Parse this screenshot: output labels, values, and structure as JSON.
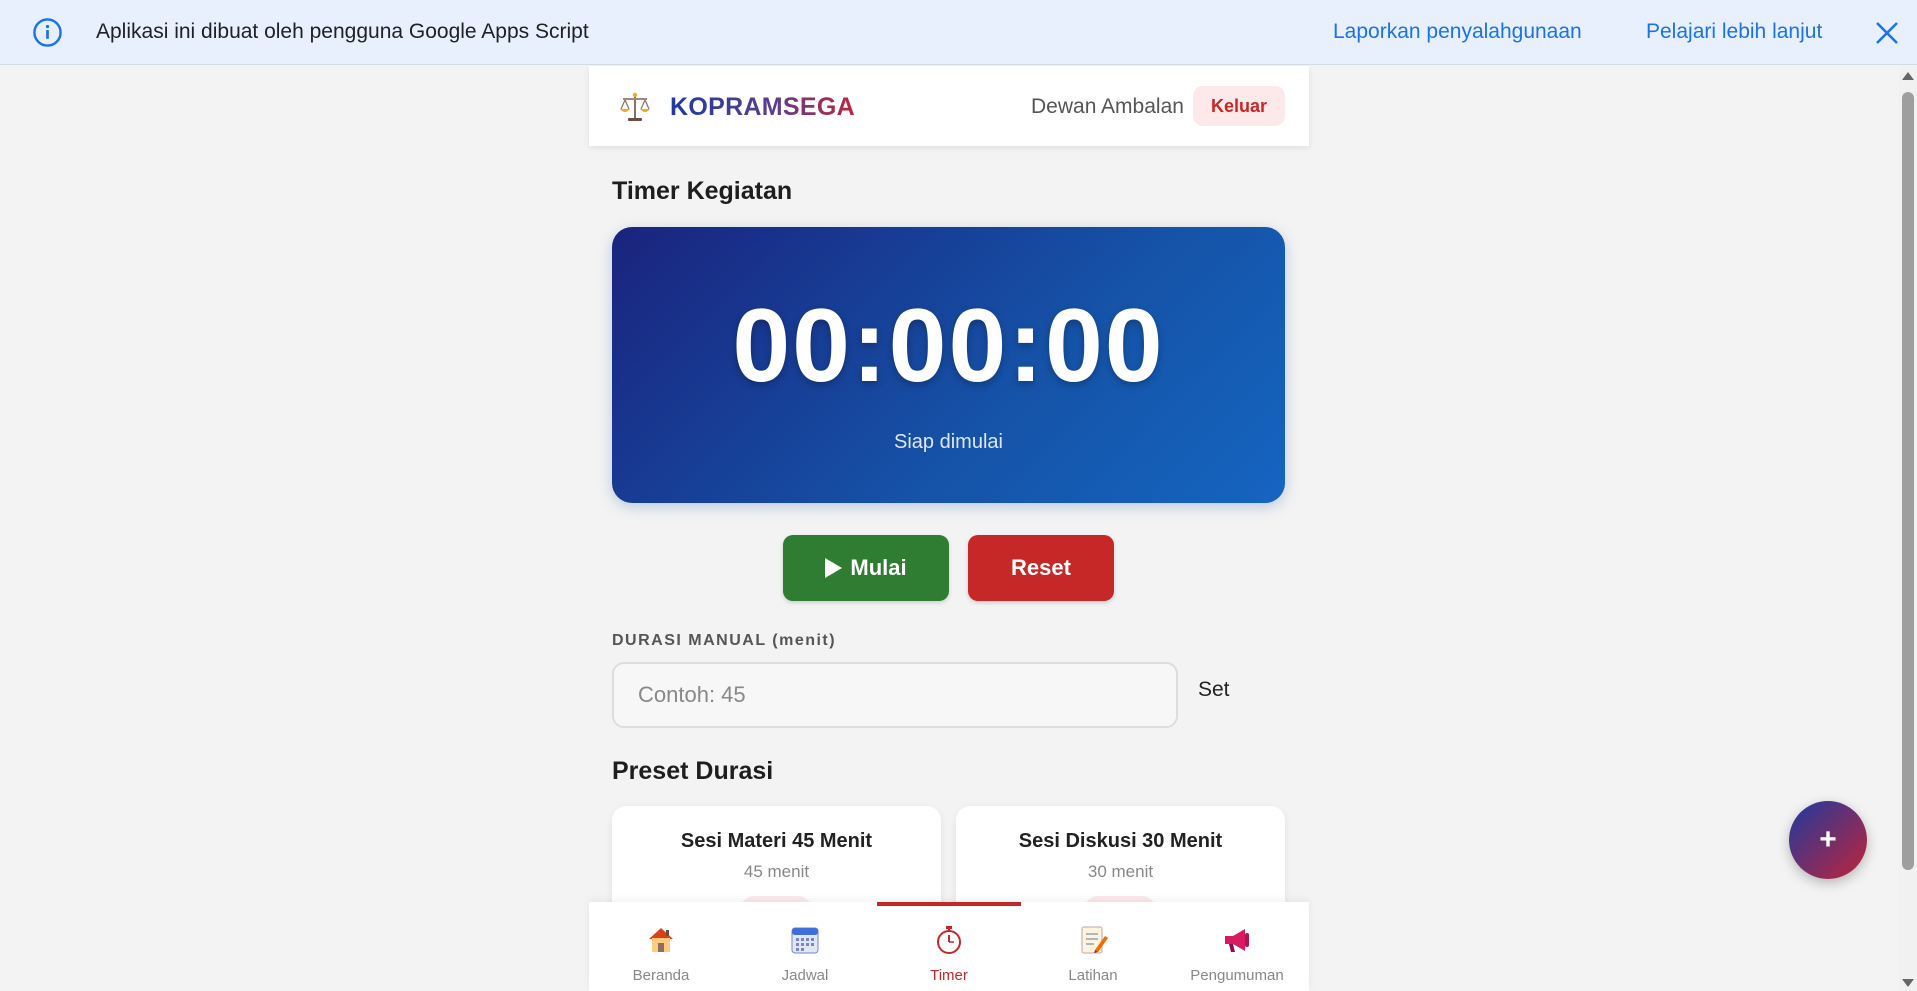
{
  "banner": {
    "message": "Aplikasi ini dibuat oleh pengguna Google Apps Script",
    "report_link": "Laporkan penyalahgunaan",
    "learn_link": "Pelajari lebih lanjut"
  },
  "header": {
    "brand": "KOPRAMSEGA",
    "user": "Dewan Ambalan",
    "logout": "Keluar"
  },
  "timer": {
    "section_title": "Timer Kegiatan",
    "display": "00:00:00",
    "status": "Siap dimulai",
    "start_label": "Mulai",
    "reset_label": "Reset"
  },
  "manual": {
    "label": "DURASI MANUAL (menit)",
    "placeholder": "Contoh: 45",
    "value": "",
    "set_label": "Set"
  },
  "presets": {
    "section_title": "Preset Durasi",
    "items": [
      {
        "title": "Sesi Materi 45 Menit",
        "subtitle": "45 menit"
      },
      {
        "title": "Sesi Diskusi 30 Menit",
        "subtitle": "30 menit"
      }
    ]
  },
  "nav": {
    "items": [
      {
        "label": "Beranda",
        "icon": "house-icon"
      },
      {
        "label": "Jadwal",
        "icon": "calendar-icon"
      },
      {
        "label": "Timer",
        "icon": "stopwatch-icon",
        "active": true
      },
      {
        "label": "Latihan",
        "icon": "memo-icon"
      },
      {
        "label": "Pengumuman",
        "icon": "megaphone-icon"
      }
    ]
  },
  "fab": {
    "label": "+"
  },
  "colors": {
    "banner_bg": "#e8f0fe",
    "link": "#1a73e8",
    "timer_gradient_start": "#1a237e",
    "timer_gradient_end": "#1565c0",
    "start_green": "#2e7d32",
    "reset_red": "#c62828",
    "active_nav": "#c62828"
  }
}
